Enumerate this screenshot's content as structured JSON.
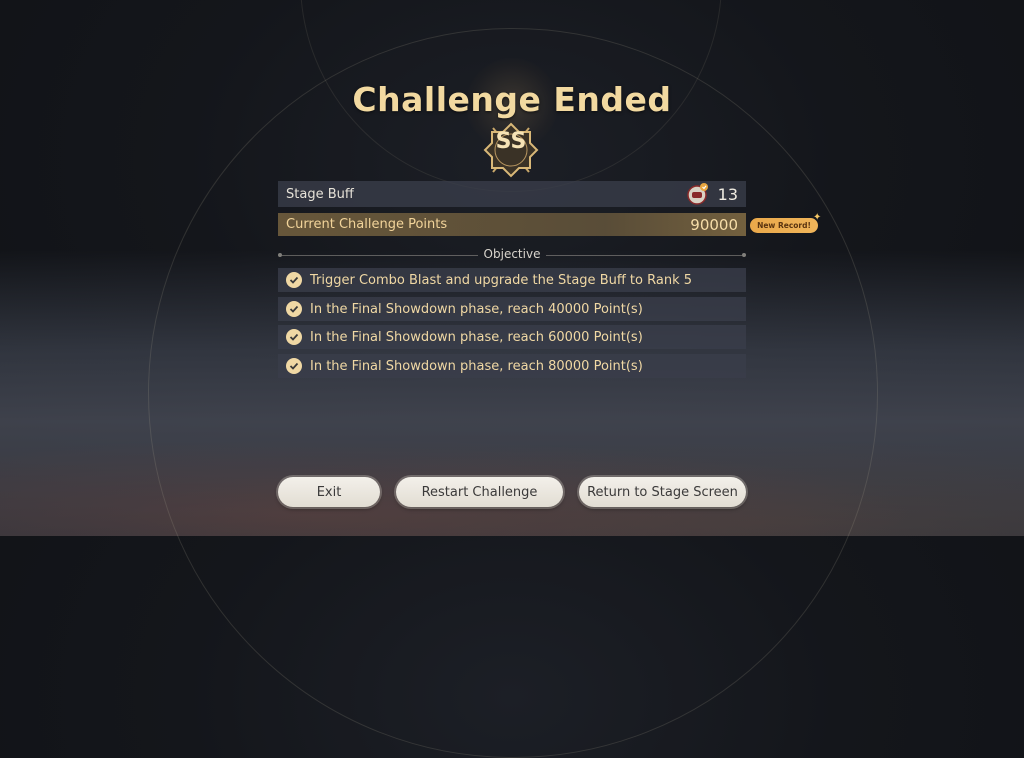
{
  "title": "Challenge Ended",
  "rank": "SS",
  "stage_buff": {
    "label": "Stage Buff",
    "value": "13",
    "icon": "stage-buff-icon"
  },
  "challenge_points": {
    "label": "Current Challenge Points",
    "value": "90000",
    "badge": "New Record!"
  },
  "objective_header": "Objective",
  "objectives": [
    {
      "text": "Trigger Combo Blast and upgrade the Stage Buff to Rank 5",
      "completed": true
    },
    {
      "text": "In the Final Showdown phase, reach 40000 Point(s)",
      "completed": true
    },
    {
      "text": "In the Final Showdown phase, reach 60000 Point(s)",
      "completed": true
    },
    {
      "text": "In the Final Showdown phase, reach 80000 Point(s)",
      "completed": true
    }
  ],
  "buttons": {
    "exit": "Exit",
    "restart": "Restart Challenge",
    "return": "Return to Stage Screen"
  },
  "colors": {
    "accent_gold": "#f2d9a0",
    "points_bar": "#6e5c3c",
    "new_record": "#e9a84a"
  }
}
